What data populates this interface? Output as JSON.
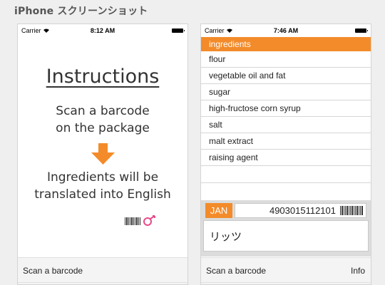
{
  "page": {
    "heading": "iPhone スクリーンショット"
  },
  "left_phone": {
    "status": {
      "carrier": "Carrier",
      "time": "8:12 AM"
    },
    "title": "Instructions",
    "scan_line_1": "Scan a barcode",
    "scan_line_2": "on the package",
    "ingredients_line_1": "Ingredients will be",
    "ingredients_line_2": "translated into English",
    "toolbar": {
      "scan_label": "Scan a barcode"
    }
  },
  "right_phone": {
    "status": {
      "carrier": "Carrier",
      "time": "7:46 AM"
    },
    "ingredients_header": "ingredients",
    "ingredients": [
      "flour",
      "vegetable oil and fat",
      "sugar",
      "high-fructose corn syrup",
      "salt",
      "malt extract",
      "raising agent",
      ""
    ],
    "jan_label": "JAN",
    "jan_code": "4903015112101",
    "product_name": "リッツ",
    "toolbar": {
      "scan_label": "Scan a barcode",
      "info_label": "Info"
    }
  },
  "colors": {
    "accent": "#f38b2a",
    "bar": "#f4f4f4",
    "panel": "#dcdcdc"
  },
  "icons": [
    "wifi-icon",
    "battery-icon",
    "down-arrow-icon",
    "barcode-logo-icon",
    "barcode-icon"
  ]
}
